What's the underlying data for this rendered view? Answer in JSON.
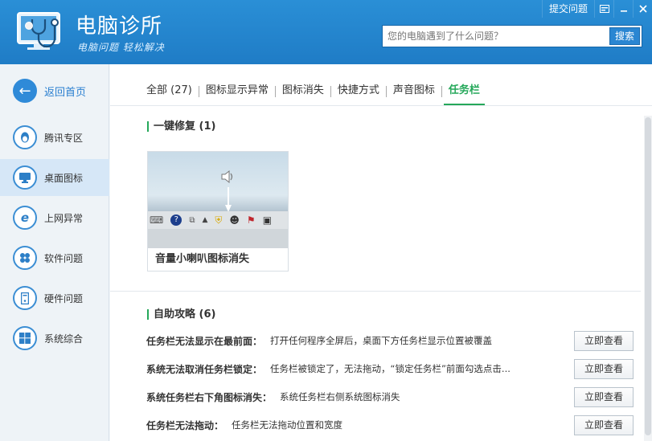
{
  "header": {
    "title": "电脑诊所",
    "slogan": "电脑问题 轻松解决",
    "submit_label": "提交问题",
    "search_placeholder": "您的电脑遇到了什么问题？",
    "search_button": "搜索"
  },
  "sidebar": {
    "items": [
      {
        "label": "返回首页",
        "icon": "back-arrow-icon"
      },
      {
        "label": "腾讯专区",
        "icon": "qq-penguin-icon"
      },
      {
        "label": "桌面图标",
        "icon": "monitor-icon"
      },
      {
        "label": "上网异常",
        "icon": "ie-icon"
      },
      {
        "label": "软件问题",
        "icon": "software-icon"
      },
      {
        "label": "硬件问题",
        "icon": "hardware-icon"
      },
      {
        "label": "系统综合",
        "icon": "windows-icon"
      }
    ],
    "active_index": 2
  },
  "tabs": [
    {
      "label": "全部 (27)"
    },
    {
      "label": "图标显示异常"
    },
    {
      "label": "图标消失"
    },
    {
      "label": "快捷方式"
    },
    {
      "label": "声音图标"
    },
    {
      "label": "任务栏"
    }
  ],
  "active_tab": 5,
  "fix_section": {
    "heading": "一键修复 (1)",
    "cards": [
      {
        "title": "音量小喇叭图标消失"
      }
    ]
  },
  "guide_section": {
    "heading": "自助攻略 (6)",
    "button_label": "立即查看",
    "items": [
      {
        "title": "任务栏无法显示在最前面：",
        "desc": "打开任何程序全屏后，桌面下方任务栏显示位置被覆盖"
      },
      {
        "title": "系统无法取消任务栏锁定：",
        "desc": "任务栏被锁定了，无法拖动，“锁定任务栏”前面勾选点击..."
      },
      {
        "title": "系统任务栏右下角图标消失：",
        "desc": "系统任务栏右侧系统图标消失"
      },
      {
        "title": "任务栏无法拖动：",
        "desc": "任务栏无法拖动位置和宽度"
      }
    ]
  },
  "colors": {
    "header_bg": "#2187d0",
    "accent_green": "#25a85a",
    "sidebar_active": "#d6e7f7"
  }
}
